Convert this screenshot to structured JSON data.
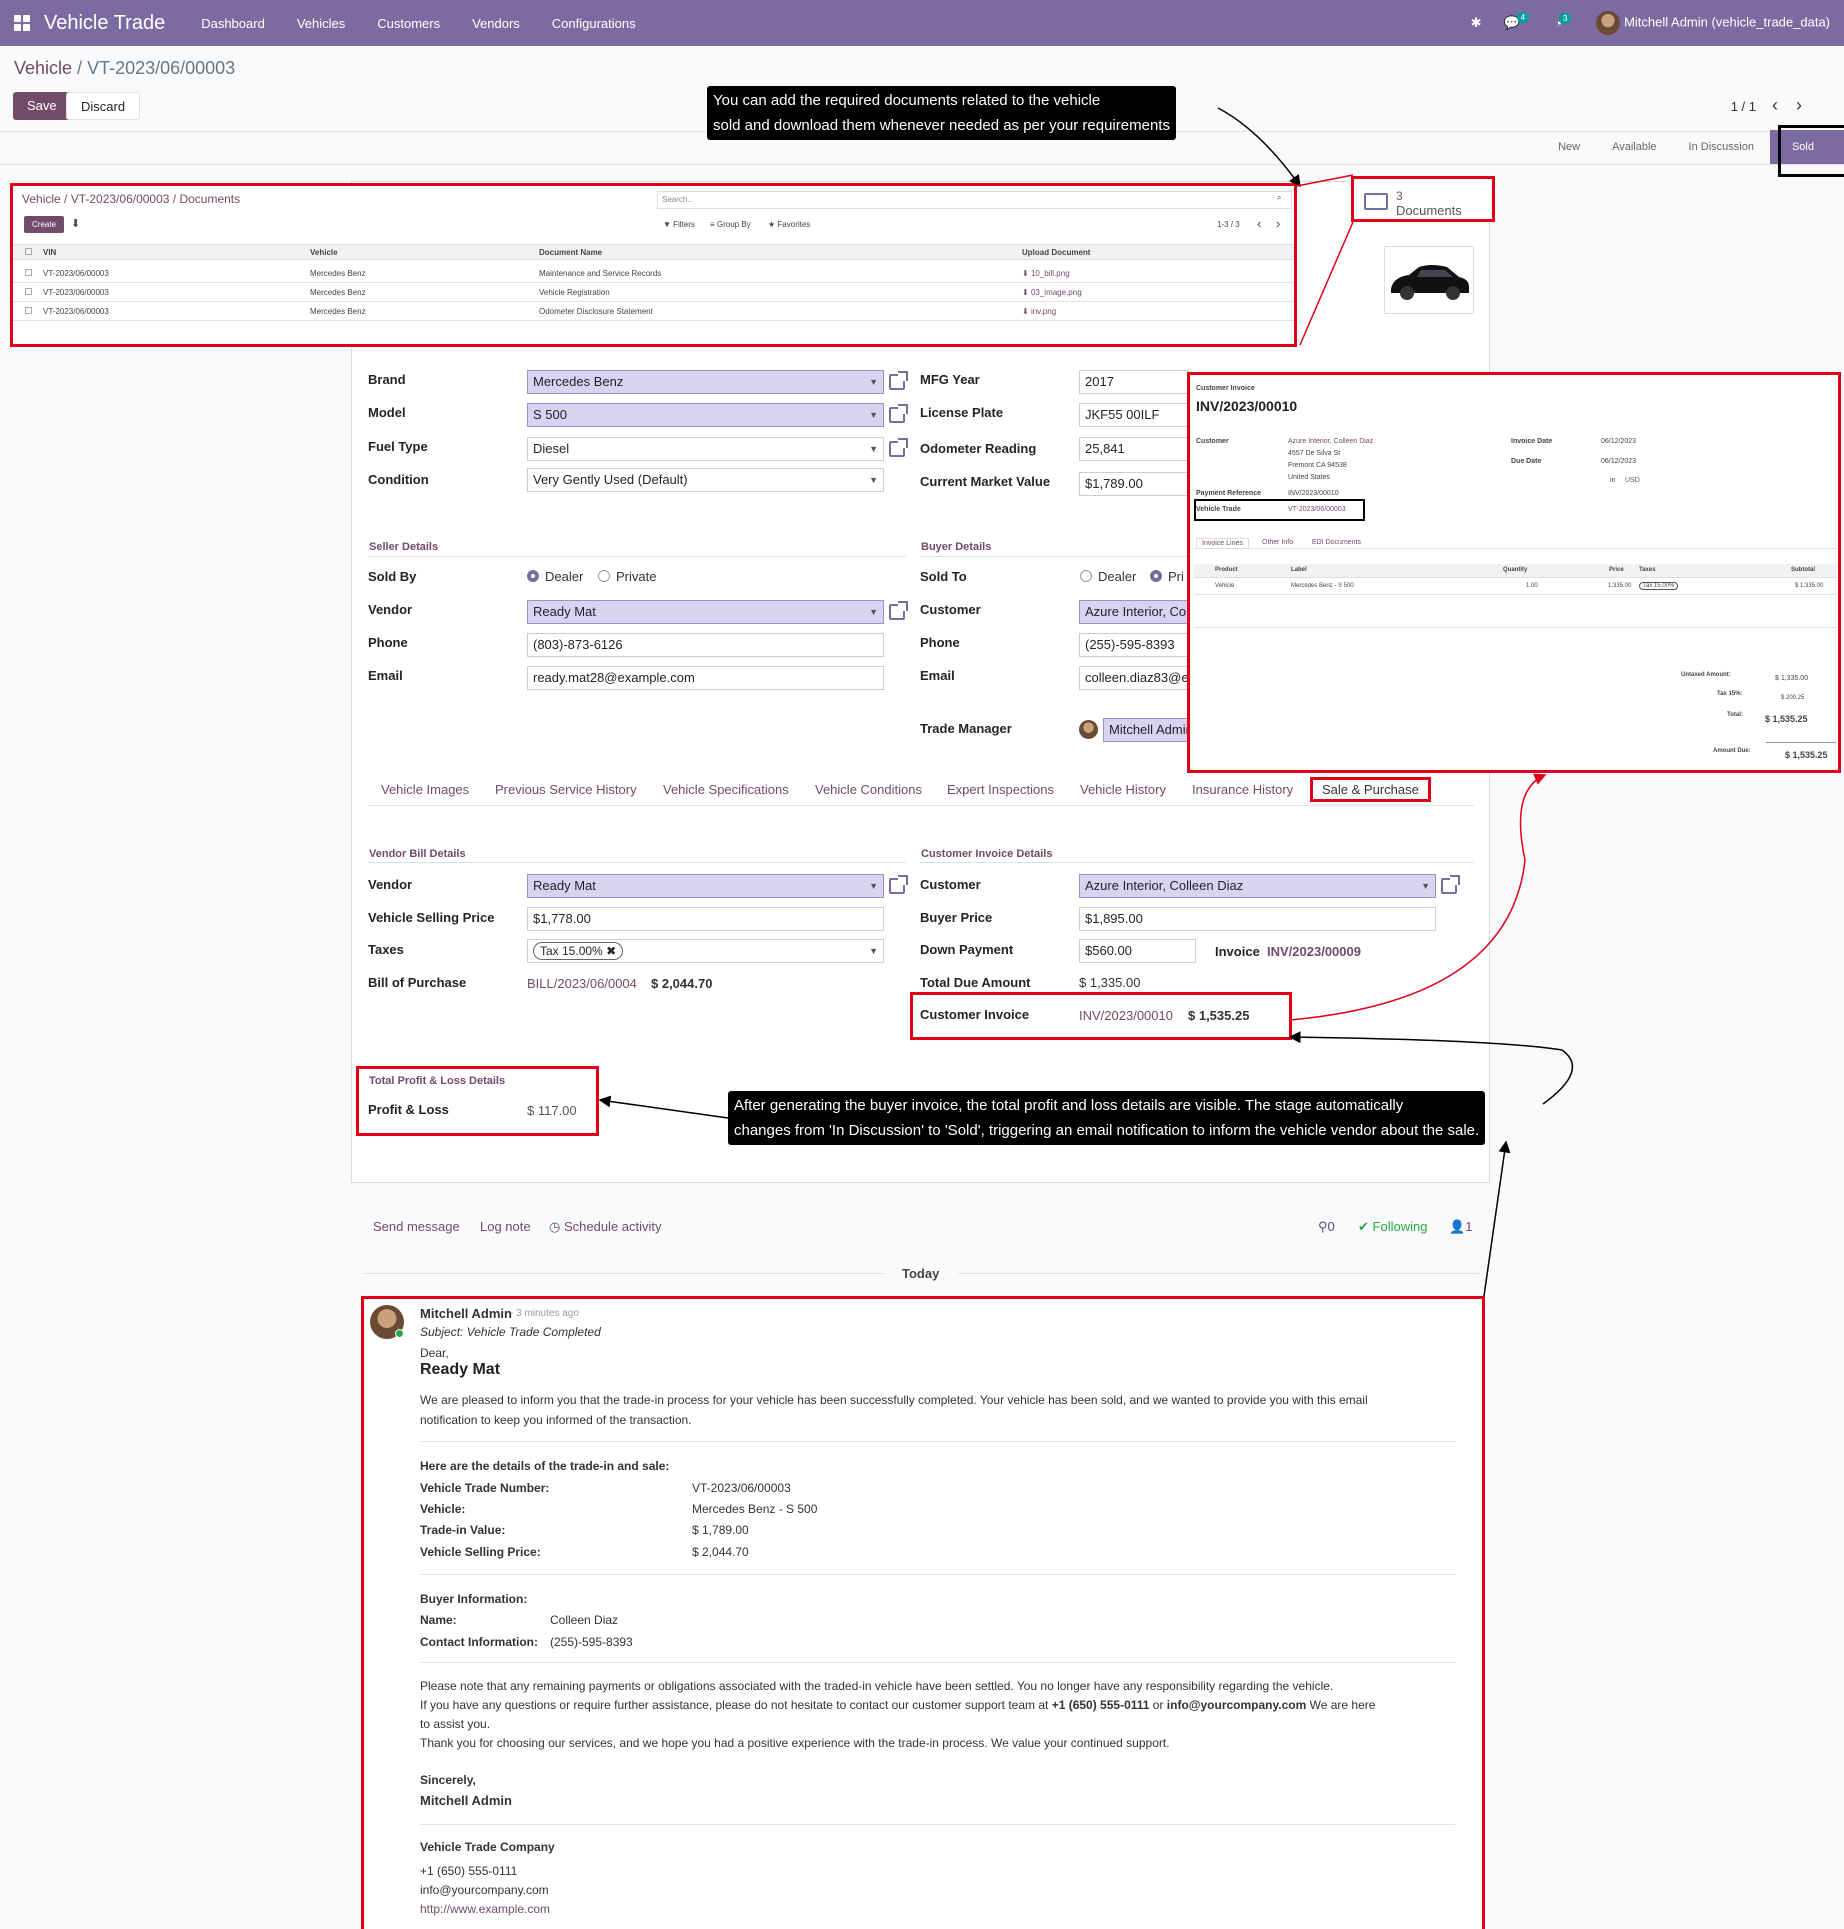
{
  "topbar": {
    "brand": "Vehicle Trade",
    "menu": [
      "Dashboard",
      "Vehicles",
      "Customers",
      "Vendors",
      "Configurations"
    ],
    "chat_badge": "4",
    "activity_badge": "3",
    "user": "Mitchell Admin (vehicle_trade_data)"
  },
  "breadcrumb": {
    "parent": "Vehicle",
    "sep": " / ",
    "current": "VT-2023/06/00003"
  },
  "actions": {
    "save": "Save",
    "discard": "Discard"
  },
  "pager": {
    "text": "1 / 1"
  },
  "stages": [
    "New",
    "Available",
    "In Discussion",
    "Sold"
  ],
  "smart_button": {
    "count": "3",
    "label": "Documents"
  },
  "annotations": {
    "docs_note": [
      "You can add the required documents related to the vehicle",
      "sold and download them whenever needed as per your requirements"
    ],
    "profit_note": [
      "After generating the buyer invoice, the total profit and loss details are visible. The stage automatically",
      "changes from 'In Discussion' to 'Sold', triggering an email notification to inform the vehicle vendor about the sale."
    ]
  },
  "documents": {
    "breadcrumb": "Vehicle / VT-2023/06/00003 / Documents",
    "create": "Create",
    "search": "Search...",
    "filters": "Filters",
    "groupby": "Group By",
    "favorites": "Favorites",
    "pager": "1-3 / 3",
    "headers": [
      "VIN",
      "Vehicle",
      "Document Name",
      "Upload Document"
    ],
    "rows": [
      [
        "VT-2023/06/00003",
        "Mercedes Benz",
        "Maintenance and Service Records",
        "10_bill.png"
      ],
      [
        "VT-2023/06/00003",
        "Mercedes Benz",
        "Vehicle Registration",
        "03_image.png"
      ],
      [
        "VT-2023/06/00003",
        "Mercedes Benz",
        "Odometer Disclosure Statement",
        "inv.png"
      ]
    ]
  },
  "form": {
    "brand_label": "Brand",
    "brand": "Mercedes Benz",
    "model_label": "Model",
    "model": "S 500",
    "fuel_label": "Fuel Type",
    "fuel": "Diesel",
    "condition_label": "Condition",
    "condition": "Very Gently Used (Default)",
    "mfg_label": "MFG Year",
    "mfg": "2017",
    "plate_label": "License Plate",
    "plate": "JKF55 00ILF",
    "odo_label": "Odometer Reading",
    "odo": "25,841",
    "cmv_label": "Current Market Value",
    "cmv": "$1,789.00",
    "seller_section": "Seller Details",
    "buyer_section": "Buyer Details",
    "soldby_label": "Sold By",
    "dealer": "Dealer",
    "private": "Private",
    "vendor_label": "Vendor",
    "vendor": "Ready Mat",
    "phone_label": "Phone",
    "seller_phone": "(803)-873-6126",
    "email_label": "Email",
    "seller_email": "ready.mat28@example.com",
    "soldto_label": "Sold To",
    "private_short": "Pri",
    "customer_label": "Customer",
    "customer_short": "Azure Interior, Co",
    "buyer_phone": "(255)-595-8393",
    "buyer_email": "colleen.diaz83@e",
    "tm_label": "Trade Manager",
    "tm": "Mitchell Admin"
  },
  "tabs": [
    "Vehicle Images",
    "Previous Service History",
    "Vehicle Specifications",
    "Vehicle Conditions",
    "Expert Inspections",
    "Vehicle History",
    "Insurance History",
    "Sale & Purchase"
  ],
  "sale": {
    "vendor_section": "Vendor Bill Details",
    "customer_section": "Customer Invoice Details",
    "vendor_label": "Vendor",
    "vendor": "Ready Mat",
    "vsp_label": "Vehicle Selling Price",
    "vsp": "$1,778.00",
    "taxes_label": "Taxes",
    "tax_tag": "Tax 15.00%",
    "bill_label": "Bill of Purchase",
    "bill": "BILL/2023/06/0004",
    "bill_amount": "$ 2,044.70",
    "customer_label": "Customer",
    "customer": "Azure Interior, Colleen Diaz",
    "buyer_price_label": "Buyer Price",
    "buyer_price": "$1,895.00",
    "down_label": "Down Payment",
    "down": "$560.00",
    "invoice_label": "Invoice",
    "invoice": "INV/2023/00009",
    "due_label": "Total Due Amount",
    "due": "$ 1,335.00",
    "ci_label": "Customer Invoice",
    "ci": "INV/2023/00010",
    "ci_amount": "$ 1,535.25",
    "pl_section": "Total Profit & Loss Details",
    "pl_label": "Profit & Loss",
    "pl": "$ 117.00"
  },
  "invoice": {
    "kind": "Customer Invoice",
    "number": "INV/2023/00010",
    "customer_label": "Customer",
    "address": [
      "Azure Interior, Colleen Diaz",
      "4557 De Silva St",
      "Fremont CA 94538",
      "United States"
    ],
    "inv_date_label": "Invoice Date",
    "inv_date": "06/12/2023",
    "due_date_label": "Due Date",
    "due_date": "06/12/2023",
    "currency_in": "in",
    "currency": "USD",
    "payref_label": "Payment Reference",
    "payref": "INV/2023/00010",
    "vt_label": "Vehicle Trade",
    "vt": "VT-2023/06/00003",
    "tabs": [
      "Invoice Lines",
      "Other Info",
      "EDI Documents"
    ],
    "headers": [
      "Product",
      "Label",
      "Quantity",
      "Price",
      "Taxes",
      "Subtotal"
    ],
    "line": [
      "Vehicle",
      "Mercedes Benz - S 500",
      "1.00",
      "1,335.00",
      "Tax 15.00%",
      "$ 1,335.00"
    ],
    "untaxed_label": "Untaxed Amount:",
    "untaxed": "$ 1,335.00",
    "tax_label": "Tax 15%:",
    "tax": "$ 200.25",
    "total_label": "Total:",
    "total": "$ 1,535.25",
    "amount_due_label": "Amount Due:",
    "amount_due": "$ 1,535.25"
  },
  "chatter": {
    "send": "Send message",
    "log": "Log note",
    "schedule": "Schedule activity",
    "attach": "0",
    "following": "Following",
    "followers": "1",
    "today": "Today",
    "author": "Mitchell Admin",
    "time": "- 3 minutes ago",
    "subject": "Subject: Vehicle Trade Completed",
    "dear": "Dear,",
    "vendor": "Ready Mat",
    "intro1": "We are pleased to inform you that the trade-in process for your vehicle has been successfully completed. Your vehicle has been sold, and we wanted to provide you with this email",
    "intro2": "notification to keep you informed of the transaction.",
    "details_title": "Here are the details of the trade-in and sale:",
    "d1l": "Vehicle Trade Number:",
    "d1v": "VT-2023/06/00003",
    "d2l": "Vehicle:",
    "d2v": "Mercedes Benz -  S 500",
    "d3l": "Trade-in Value:",
    "d3v": "$ 1,789.00",
    "d4l": "Vehicle Selling Price:",
    "d4v": "$ 2,044.70",
    "buyer_title": "Buyer Information:",
    "b1l": "Name:",
    "b1v": "Colleen Diaz",
    "b2l": "Contact Information:",
    "b2v": "(255)-595-8393",
    "p1": "Please note that any remaining payments or obligations associated with the traded-in vehicle have been settled. You no longer have any responsibility regarding the vehicle.",
    "p2a": "If you have any questions or require further assistance, please do not hesitate to contact our customer support team at ",
    "p2phone": "+1 (650) 555-0111",
    "p2or": " or ",
    "p2mail": "info@yourcompany.com",
    "p2b": " We are here",
    "p3": "to assist you.",
    "p4": "Thank you for choosing our services, and we hope you had a positive experience with the trade-in process. We value your continued support.",
    "sincerely": "Sincerely,",
    "signer": "Mitchell Admin",
    "company": "Vehicle Trade Company",
    "c_phone": "+1 (650) 555-0111",
    "c_mail": "info@yourcompany.com",
    "c_web": "http://www.example.com"
  }
}
